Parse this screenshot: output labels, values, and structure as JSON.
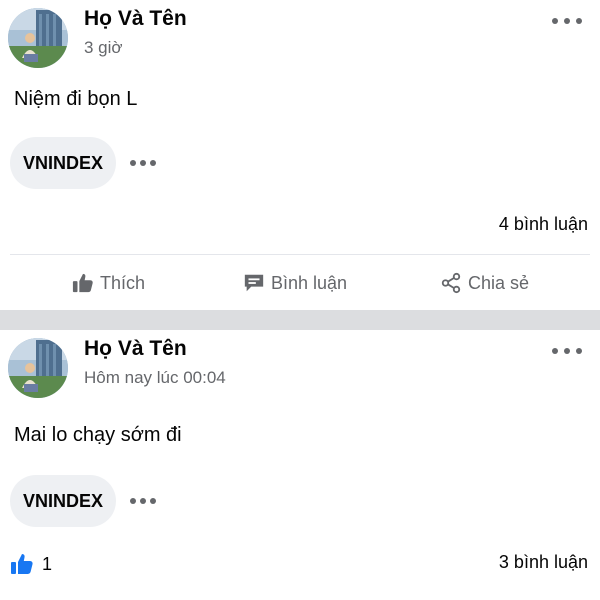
{
  "posts": [
    {
      "author": "Họ Và Tên",
      "time": "3 giờ",
      "text": "Niệm đi bọn L",
      "tag": "VNINDEX",
      "comments": "4 bình luận",
      "actions": {
        "like": "Thích",
        "comment": "Bình luận",
        "share": "Chia sẻ"
      },
      "icons": {
        "like": "thumbs-up-icon",
        "comment": "comment-icon",
        "share": "share-icon",
        "more": "more-options-icon"
      }
    },
    {
      "author": "Họ Và Tên",
      "time": "Hôm nay lúc 00:04",
      "text": "Mai lo chạy sớm đi",
      "tag": "VNINDEX",
      "likes": "1",
      "comments": "3 bình luận",
      "icons": {
        "reaction": "like-reaction-icon",
        "more": "more-options-icon"
      }
    }
  ],
  "colors": {
    "text": "#050505",
    "secondary": "#65676b",
    "chip_bg": "#eef0f3",
    "separator": "#dcdde0",
    "like_blue": "#1877f2"
  }
}
